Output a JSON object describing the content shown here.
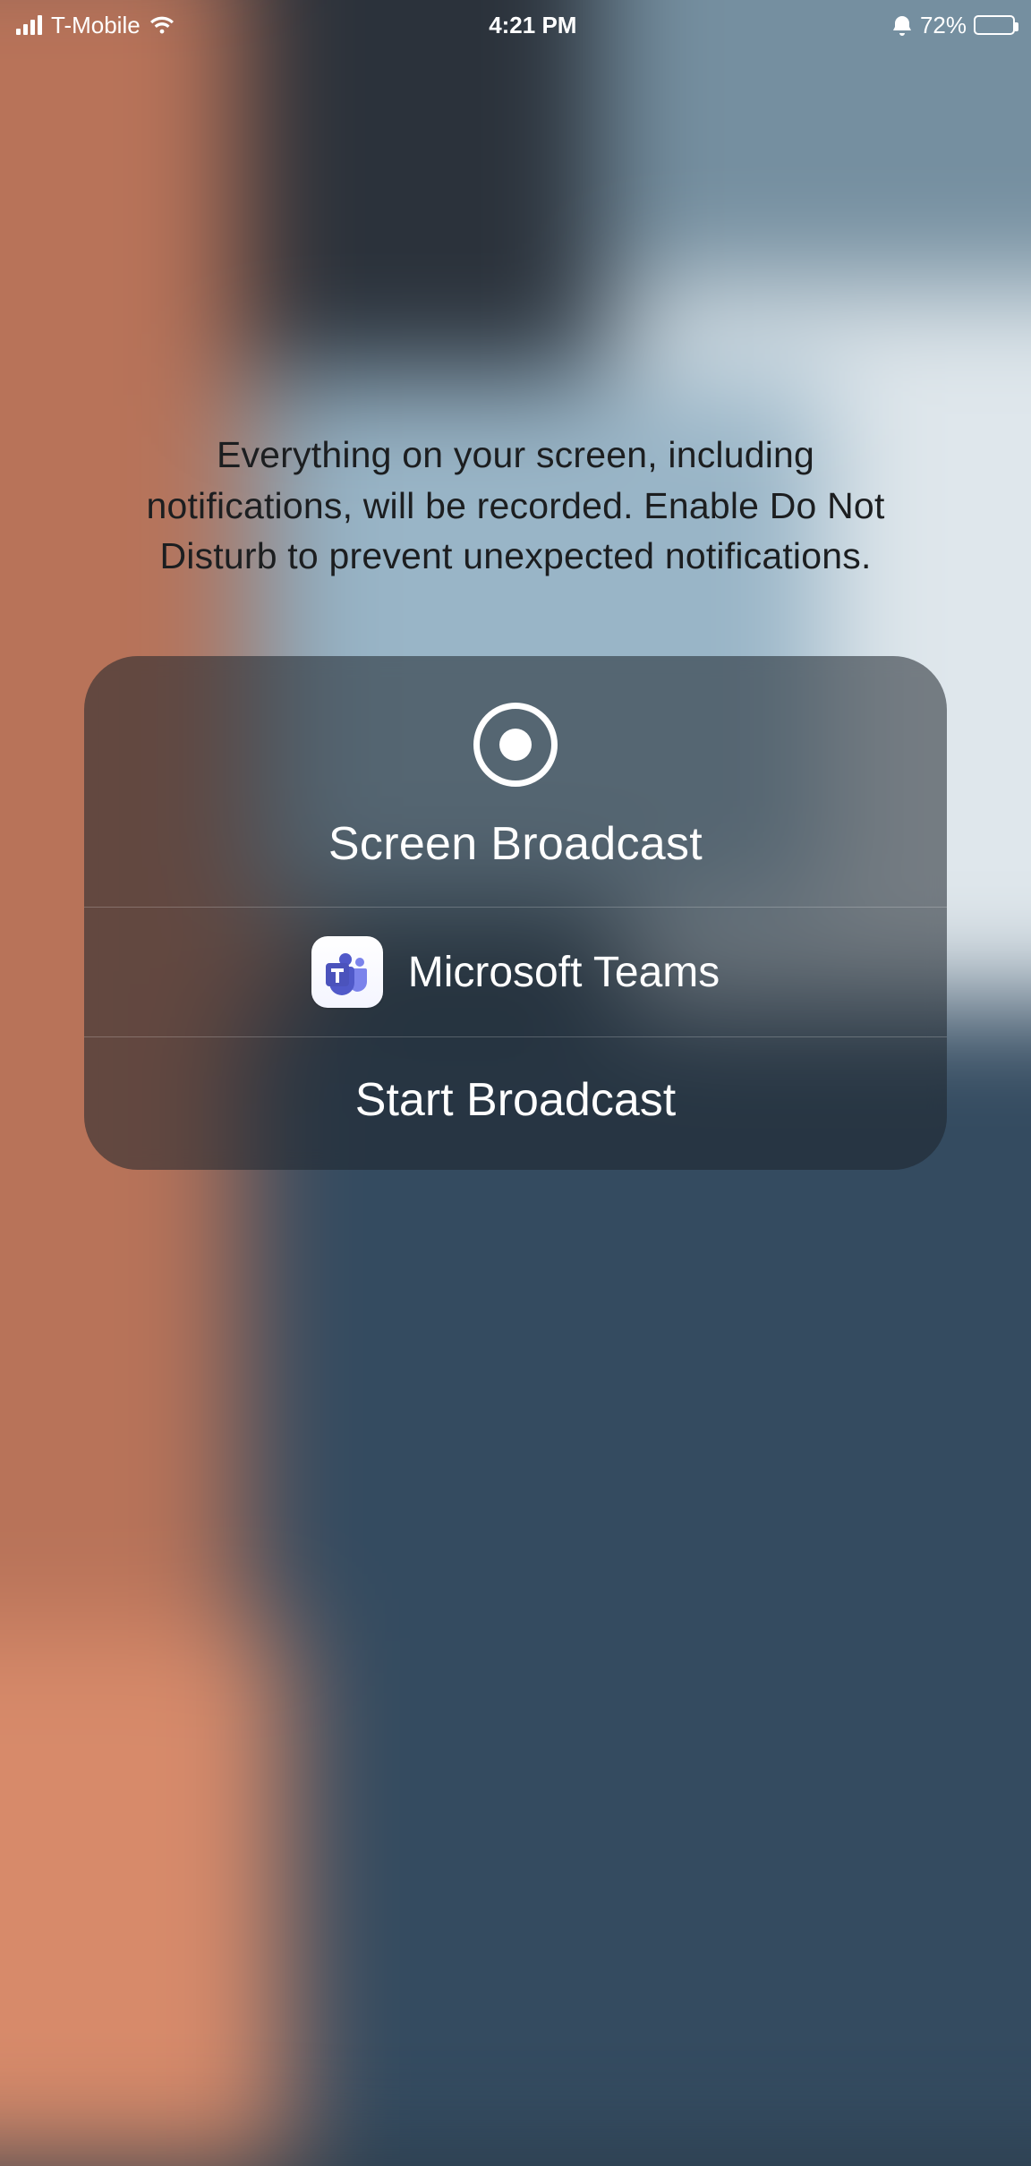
{
  "status_bar": {
    "carrier": "T-Mobile",
    "time": "4:21 PM",
    "battery_percent": "72%",
    "battery_fill_pct": 72
  },
  "notice_text": "Everything on your screen, including notifications, will be recorded. Enable Do Not Disturb to prevent unexpected notifications.",
  "card": {
    "title": "Screen Broadcast",
    "selected_app": "Microsoft Teams",
    "start_label": "Start Broadcast"
  }
}
